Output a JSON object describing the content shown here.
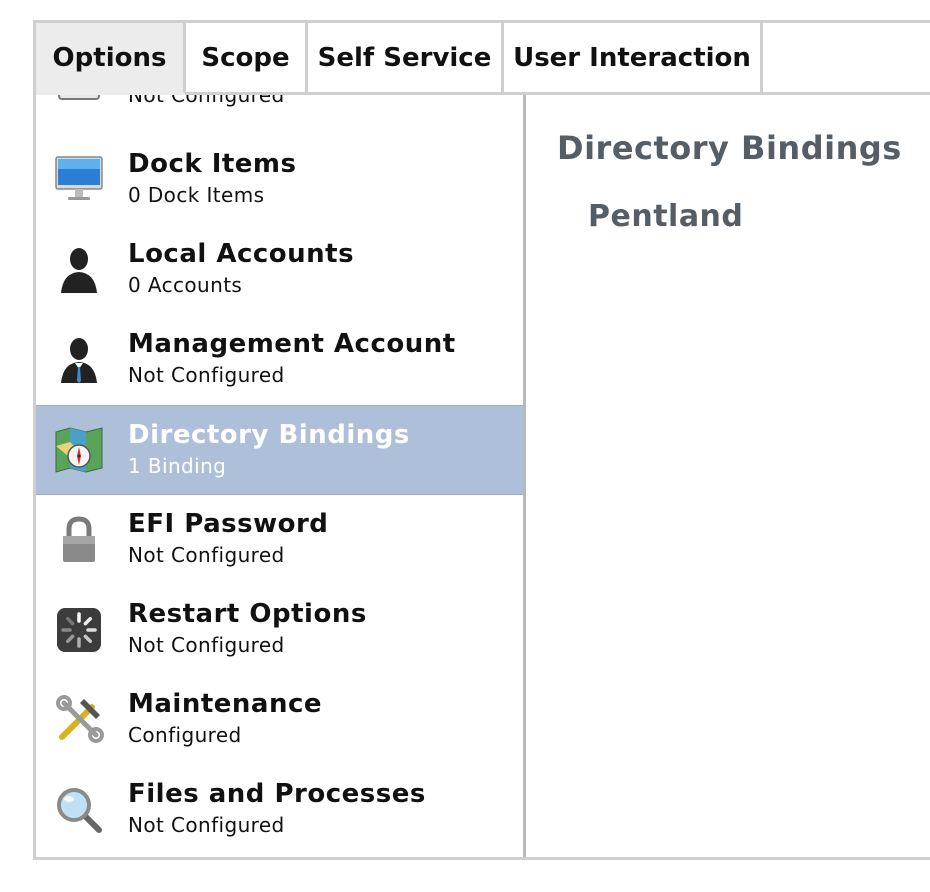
{
  "tabs": [
    {
      "label": "Options",
      "active": true
    },
    {
      "label": "Scope",
      "active": false
    },
    {
      "label": "Self Service",
      "active": false
    },
    {
      "label": "User Interaction",
      "active": false
    }
  ],
  "sidebar": {
    "items": [
      {
        "title": "",
        "subtitle": "Not Configured",
        "icon": "clock-icon"
      },
      {
        "title": "Dock Items",
        "subtitle": "0 Dock Items",
        "icon": "monitor-icon"
      },
      {
        "title": "Local Accounts",
        "subtitle": "0 Accounts",
        "icon": "user-silhouette-icon"
      },
      {
        "title": "Management Account",
        "subtitle": "Not Configured",
        "icon": "manager-user-icon"
      },
      {
        "title": "Directory Bindings",
        "subtitle": "1 Binding",
        "icon": "map-compass-icon",
        "selected": true
      },
      {
        "title": "EFI Password",
        "subtitle": "Not Configured",
        "icon": "padlock-icon"
      },
      {
        "title": "Restart Options",
        "subtitle": "Not Configured",
        "icon": "spinner-icon"
      },
      {
        "title": "Maintenance",
        "subtitle": "Configured",
        "icon": "tools-icon"
      },
      {
        "title": "Files and Processes",
        "subtitle": "Not Configured",
        "icon": "magnifier-icon"
      }
    ]
  },
  "detail": {
    "title": "Directory Bindings",
    "entries": [
      "Pentland"
    ]
  },
  "colors": {
    "selected_bg": "#aebfda",
    "detail_text": "#555d66",
    "border": "#cfcfcf"
  }
}
